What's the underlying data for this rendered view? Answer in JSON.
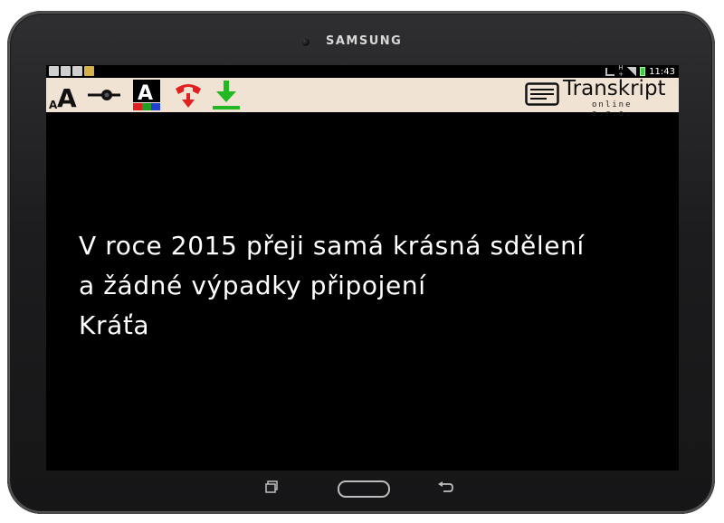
{
  "device": {
    "brand": "SAMSUNG"
  },
  "statusbar": {
    "time": "11:43",
    "left_icons": [
      "mail-icon",
      "e-icon",
      "calendar-icon",
      "cleaner-icon"
    ],
    "right_icons": [
      "mute-icon",
      "network-icon",
      "signal-icon",
      "battery-icon"
    ]
  },
  "toolbar": {
    "font_size_icon": "font-size-icon",
    "font_size_label": "A",
    "slider_icon": "slider-icon",
    "color_icon": "text-color-icon",
    "color_label": "A",
    "hangup_icon": "hangup-phone-icon",
    "download_icon": "download-icon",
    "colors": {
      "hangup": "#e2201f",
      "download": "#22b822",
      "swatch_red": "#e02020",
      "swatch_green": "#20a020",
      "swatch_blue": "#2040d0"
    }
  },
  "logo": {
    "title": "Transkript",
    "subtitle": "online s.r.o."
  },
  "caption": {
    "lines": [
      "V roce 2015 přeji samá krásná sdělení",
      "a žádné výpadky připojení",
      "Kráťa"
    ]
  },
  "navbar": {
    "recent_icon": "recent-apps-icon",
    "home_icon": "home-button",
    "back_icon": "back-icon"
  }
}
